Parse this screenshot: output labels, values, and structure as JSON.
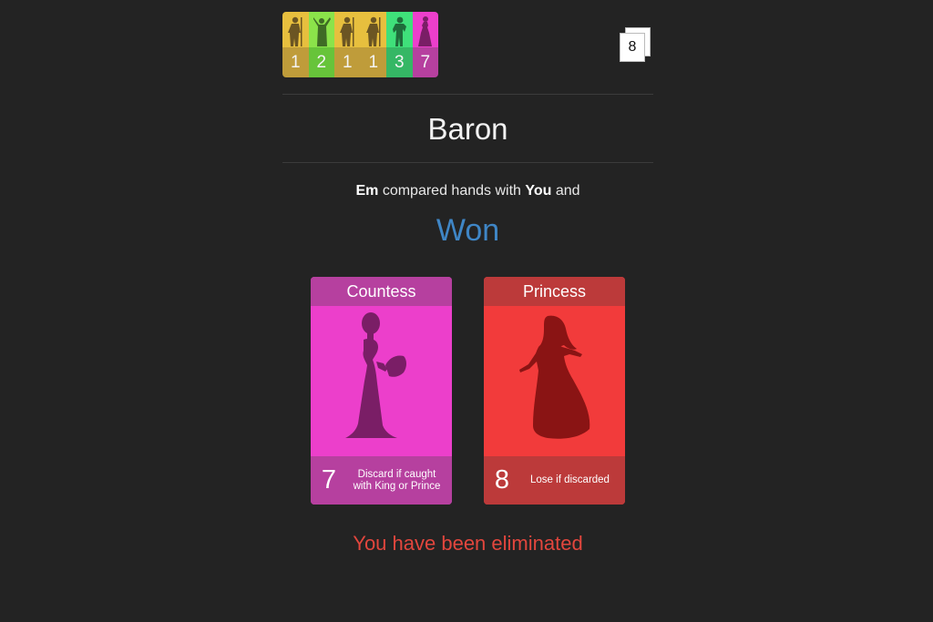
{
  "history": [
    {
      "value": "1",
      "icon": "guard-silhouette-icon",
      "top": "#e7bf3e",
      "bottom": "#bf9c3a",
      "ink": "#6b5523"
    },
    {
      "value": "2",
      "icon": "priest-silhouette-icon",
      "top": "#8be34a",
      "bottom": "#67c43a",
      "ink": "#3f6b25"
    },
    {
      "value": "1",
      "icon": "guard-silhouette-icon",
      "top": "#e7bf3e",
      "bottom": "#bf9c3a",
      "ink": "#6b5523"
    },
    {
      "value": "1",
      "icon": "guard-silhouette-icon",
      "top": "#e7bf3e",
      "bottom": "#bf9c3a",
      "ink": "#6b5523"
    },
    {
      "value": "3",
      "icon": "baron-silhouette-icon",
      "top": "#3fe07a",
      "bottom": "#35b765",
      "ink": "#1f6b3a"
    },
    {
      "value": "7",
      "icon": "countess-silhouette-icon",
      "top": "#ec3fcb",
      "bottom": "#b6409f",
      "ink": "#7a1e66"
    }
  ],
  "deck": {
    "count": "8"
  },
  "title": "Baron",
  "message": {
    "actor": "Em",
    "middle": " compared hands with ",
    "target": "You",
    "end": " and"
  },
  "result": "Won",
  "cards": [
    {
      "name": "Countess",
      "value": "7",
      "text_line1": "Discard if caught",
      "text_line2": "with King or Prince",
      "icon": "countess-silhouette-icon"
    },
    {
      "name": "Princess",
      "value": "8",
      "text_line1": "Lose if discarded",
      "text_line2": "",
      "icon": "princess-silhouette-icon"
    }
  ],
  "status": "You have been eliminated",
  "colors": {
    "background": "#232323",
    "won": "#3f86c6",
    "eliminated": "#e2463d",
    "countess": "#ec3fcb",
    "princess": "#f23b3b"
  }
}
